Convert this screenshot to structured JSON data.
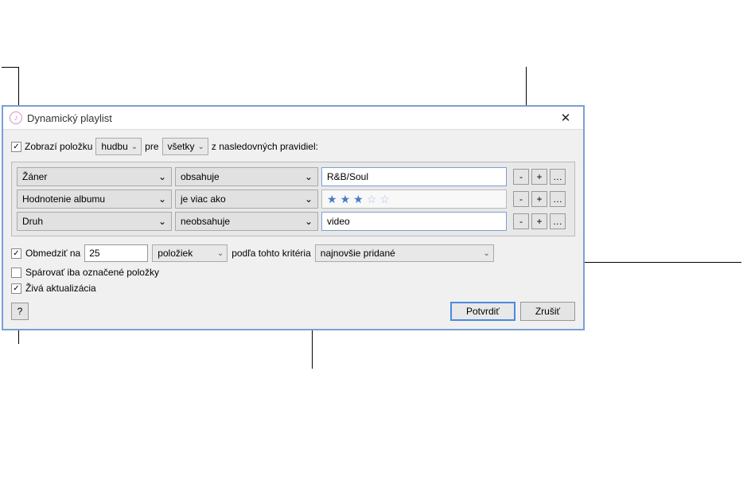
{
  "window": {
    "title": "Dynamický playlist"
  },
  "match_line": {
    "prefix": "Zobrazí položku",
    "media": "hudbu",
    "for": "pre",
    "scope": "všetky",
    "suffix": "z nasledovných pravidiel:"
  },
  "rules": [
    {
      "field": "Žáner",
      "op": "obsahuje",
      "value": "R&B/Soul",
      "type": "text"
    },
    {
      "field": "Hodnotenie albumu",
      "op": "je viac ako",
      "stars_filled": 3,
      "stars_total": 5,
      "type": "stars"
    },
    {
      "field": "Druh",
      "op": "neobsahuje",
      "value": "video",
      "type": "text"
    }
  ],
  "row_buttons": {
    "minus": "-",
    "plus": "+",
    "more": "…"
  },
  "limit": {
    "label": "Obmedziť na",
    "count": "25",
    "unit": "položiek",
    "by_label": "podľa tohto kritéria",
    "criteria": "najnovšie pridané"
  },
  "match_only": {
    "label": "Spárovať iba označené položky",
    "checked": false
  },
  "live_update": {
    "label": "Živá aktualizácia",
    "checked": true
  },
  "buttons": {
    "help": "?",
    "ok": "Potvrdiť",
    "cancel": "Zrušiť"
  }
}
